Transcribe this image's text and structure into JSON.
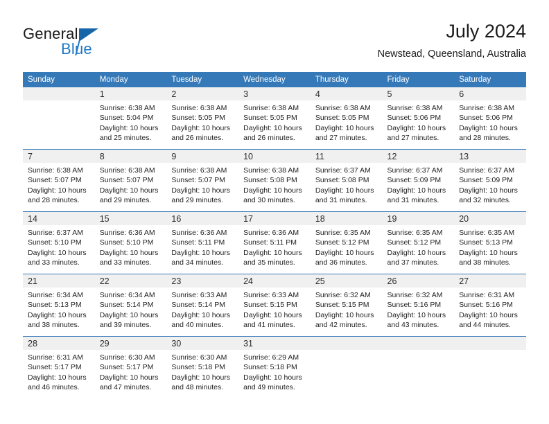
{
  "brand": {
    "word1": "General",
    "word2": "Blue",
    "triangle_color": "#1565a8",
    "blue_color": "#1f77c2"
  },
  "header": {
    "month_title": "July 2024",
    "location": "Newstead, Queensland, Australia"
  },
  "theme": {
    "header_blue": "#3579b8",
    "band_gray": "#f0f0f0",
    "text": "#232323"
  },
  "weekdays": [
    "Sunday",
    "Monday",
    "Tuesday",
    "Wednesday",
    "Thursday",
    "Friday",
    "Saturday"
  ],
  "weeks": [
    [
      {
        "day": "",
        "sunrise": "",
        "sunset": "",
        "daylight1": "",
        "daylight2": "",
        "empty": true
      },
      {
        "day": "1",
        "sunrise": "Sunrise: 6:38 AM",
        "sunset": "Sunset: 5:04 PM",
        "daylight1": "Daylight: 10 hours",
        "daylight2": "and 25 minutes."
      },
      {
        "day": "2",
        "sunrise": "Sunrise: 6:38 AM",
        "sunset": "Sunset: 5:05 PM",
        "daylight1": "Daylight: 10 hours",
        "daylight2": "and 26 minutes."
      },
      {
        "day": "3",
        "sunrise": "Sunrise: 6:38 AM",
        "sunset": "Sunset: 5:05 PM",
        "daylight1": "Daylight: 10 hours",
        "daylight2": "and 26 minutes."
      },
      {
        "day": "4",
        "sunrise": "Sunrise: 6:38 AM",
        "sunset": "Sunset: 5:05 PM",
        "daylight1": "Daylight: 10 hours",
        "daylight2": "and 27 minutes."
      },
      {
        "day": "5",
        "sunrise": "Sunrise: 6:38 AM",
        "sunset": "Sunset: 5:06 PM",
        "daylight1": "Daylight: 10 hours",
        "daylight2": "and 27 minutes."
      },
      {
        "day": "6",
        "sunrise": "Sunrise: 6:38 AM",
        "sunset": "Sunset: 5:06 PM",
        "daylight1": "Daylight: 10 hours",
        "daylight2": "and 28 minutes."
      }
    ],
    [
      {
        "day": "7",
        "sunrise": "Sunrise: 6:38 AM",
        "sunset": "Sunset: 5:07 PM",
        "daylight1": "Daylight: 10 hours",
        "daylight2": "and 28 minutes."
      },
      {
        "day": "8",
        "sunrise": "Sunrise: 6:38 AM",
        "sunset": "Sunset: 5:07 PM",
        "daylight1": "Daylight: 10 hours",
        "daylight2": "and 29 minutes."
      },
      {
        "day": "9",
        "sunrise": "Sunrise: 6:38 AM",
        "sunset": "Sunset: 5:07 PM",
        "daylight1": "Daylight: 10 hours",
        "daylight2": "and 29 minutes."
      },
      {
        "day": "10",
        "sunrise": "Sunrise: 6:38 AM",
        "sunset": "Sunset: 5:08 PM",
        "daylight1": "Daylight: 10 hours",
        "daylight2": "and 30 minutes."
      },
      {
        "day": "11",
        "sunrise": "Sunrise: 6:37 AM",
        "sunset": "Sunset: 5:08 PM",
        "daylight1": "Daylight: 10 hours",
        "daylight2": "and 31 minutes."
      },
      {
        "day": "12",
        "sunrise": "Sunrise: 6:37 AM",
        "sunset": "Sunset: 5:09 PM",
        "daylight1": "Daylight: 10 hours",
        "daylight2": "and 31 minutes."
      },
      {
        "day": "13",
        "sunrise": "Sunrise: 6:37 AM",
        "sunset": "Sunset: 5:09 PM",
        "daylight1": "Daylight: 10 hours",
        "daylight2": "and 32 minutes."
      }
    ],
    [
      {
        "day": "14",
        "sunrise": "Sunrise: 6:37 AM",
        "sunset": "Sunset: 5:10 PM",
        "daylight1": "Daylight: 10 hours",
        "daylight2": "and 33 minutes."
      },
      {
        "day": "15",
        "sunrise": "Sunrise: 6:36 AM",
        "sunset": "Sunset: 5:10 PM",
        "daylight1": "Daylight: 10 hours",
        "daylight2": "and 33 minutes."
      },
      {
        "day": "16",
        "sunrise": "Sunrise: 6:36 AM",
        "sunset": "Sunset: 5:11 PM",
        "daylight1": "Daylight: 10 hours",
        "daylight2": "and 34 minutes."
      },
      {
        "day": "17",
        "sunrise": "Sunrise: 6:36 AM",
        "sunset": "Sunset: 5:11 PM",
        "daylight1": "Daylight: 10 hours",
        "daylight2": "and 35 minutes."
      },
      {
        "day": "18",
        "sunrise": "Sunrise: 6:35 AM",
        "sunset": "Sunset: 5:12 PM",
        "daylight1": "Daylight: 10 hours",
        "daylight2": "and 36 minutes."
      },
      {
        "day": "19",
        "sunrise": "Sunrise: 6:35 AM",
        "sunset": "Sunset: 5:12 PM",
        "daylight1": "Daylight: 10 hours",
        "daylight2": "and 37 minutes."
      },
      {
        "day": "20",
        "sunrise": "Sunrise: 6:35 AM",
        "sunset": "Sunset: 5:13 PM",
        "daylight1": "Daylight: 10 hours",
        "daylight2": "and 38 minutes."
      }
    ],
    [
      {
        "day": "21",
        "sunrise": "Sunrise: 6:34 AM",
        "sunset": "Sunset: 5:13 PM",
        "daylight1": "Daylight: 10 hours",
        "daylight2": "and 38 minutes."
      },
      {
        "day": "22",
        "sunrise": "Sunrise: 6:34 AM",
        "sunset": "Sunset: 5:14 PM",
        "daylight1": "Daylight: 10 hours",
        "daylight2": "and 39 minutes."
      },
      {
        "day": "23",
        "sunrise": "Sunrise: 6:33 AM",
        "sunset": "Sunset: 5:14 PM",
        "daylight1": "Daylight: 10 hours",
        "daylight2": "and 40 minutes."
      },
      {
        "day": "24",
        "sunrise": "Sunrise: 6:33 AM",
        "sunset": "Sunset: 5:15 PM",
        "daylight1": "Daylight: 10 hours",
        "daylight2": "and 41 minutes."
      },
      {
        "day": "25",
        "sunrise": "Sunrise: 6:32 AM",
        "sunset": "Sunset: 5:15 PM",
        "daylight1": "Daylight: 10 hours",
        "daylight2": "and 42 minutes."
      },
      {
        "day": "26",
        "sunrise": "Sunrise: 6:32 AM",
        "sunset": "Sunset: 5:16 PM",
        "daylight1": "Daylight: 10 hours",
        "daylight2": "and 43 minutes."
      },
      {
        "day": "27",
        "sunrise": "Sunrise: 6:31 AM",
        "sunset": "Sunset: 5:16 PM",
        "daylight1": "Daylight: 10 hours",
        "daylight2": "and 44 minutes."
      }
    ],
    [
      {
        "day": "28",
        "sunrise": "Sunrise: 6:31 AM",
        "sunset": "Sunset: 5:17 PM",
        "daylight1": "Daylight: 10 hours",
        "daylight2": "and 46 minutes."
      },
      {
        "day": "29",
        "sunrise": "Sunrise: 6:30 AM",
        "sunset": "Sunset: 5:17 PM",
        "daylight1": "Daylight: 10 hours",
        "daylight2": "and 47 minutes."
      },
      {
        "day": "30",
        "sunrise": "Sunrise: 6:30 AM",
        "sunset": "Sunset: 5:18 PM",
        "daylight1": "Daylight: 10 hours",
        "daylight2": "and 48 minutes."
      },
      {
        "day": "31",
        "sunrise": "Sunrise: 6:29 AM",
        "sunset": "Sunset: 5:18 PM",
        "daylight1": "Daylight: 10 hours",
        "daylight2": "and 49 minutes."
      },
      {
        "day": "",
        "sunrise": "",
        "sunset": "",
        "daylight1": "",
        "daylight2": "",
        "empty": true
      },
      {
        "day": "",
        "sunrise": "",
        "sunset": "",
        "daylight1": "",
        "daylight2": "",
        "empty": true
      },
      {
        "day": "",
        "sunrise": "",
        "sunset": "",
        "daylight1": "",
        "daylight2": "",
        "empty": true
      }
    ]
  ]
}
